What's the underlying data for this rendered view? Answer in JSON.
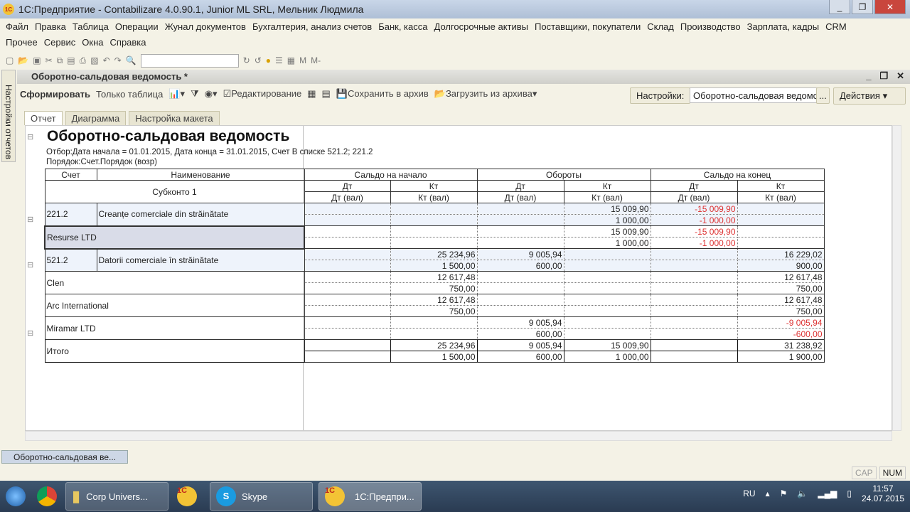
{
  "window": {
    "title": "1С:Предприятие - Contabilizare 4.0.90.1, Junior ML SRL, Мельник Людмила"
  },
  "menu1": [
    "Файл",
    "Правка",
    "Таблица",
    "Операции",
    "Жунал документов",
    "Бухгалтерия, анализ счетов",
    "Банк, касса",
    "Долгосрочные активы",
    "Поставщики, покупатели",
    "Склад",
    "Производство",
    "Зарплата, кадры",
    "CRM"
  ],
  "menu2": [
    "Прочее",
    "Сервис",
    "Окна",
    "Справка"
  ],
  "side_panel": "Настройки отчетов",
  "doc": {
    "title": "Оборотно-сальдовая ведомость *",
    "toolbar": {
      "generate": "Сформировать",
      "table_only": "Только таблица",
      "edit": "Редактирование",
      "save_archive": "Сохранить в архив",
      "load_archive": "Загрузить из архива",
      "settings_label": "Настройки:",
      "settings_value": "Оборотно-сальдовая ведомс",
      "ellipsis": "...",
      "actions": "Действия"
    },
    "tabs": [
      "Отчет",
      "Диаграмма",
      "Настройка макета"
    ]
  },
  "report": {
    "title": "Оборотно-сальдовая ведомость",
    "filter": "Отбор:Дата начала = 01.01.2015, Дата конца = 31.01.2015, Счет В списке 521.2; 221.2",
    "order": "Порядок:Счет.Порядок (возр)",
    "headers": {
      "account": "Счет",
      "name": "Наименование",
      "subconto": "Субконто 1",
      "groups": [
        "Сальдо на начало",
        "Обороты",
        "Сальдо на конец"
      ],
      "dt": "Дт",
      "kt": "Кт",
      "dt_val": "Дт (вал)",
      "kt_val": "Кт (вал)"
    },
    "rows": [
      {
        "type": "group",
        "account": "221.2",
        "name": "Creanțe comerciale din străinătate",
        "l1": [
          "",
          "",
          "",
          "15 009,90",
          "-15 009,90",
          ""
        ],
        "l2": [
          "",
          "",
          "",
          "1 000,00",
          "-1 000,00",
          ""
        ]
      },
      {
        "type": "sub",
        "name": "Resurse LTD",
        "selected": true,
        "l1": [
          "",
          "",
          "",
          "15 009,90",
          "-15 009,90",
          ""
        ],
        "l2": [
          "",
          "",
          "",
          "1 000,00",
          "-1 000,00",
          ""
        ]
      },
      {
        "type": "group",
        "account": "521.2",
        "name": "Datorii comerciale în străinătate",
        "l1": [
          "",
          "25 234,96",
          "9 005,94",
          "",
          "",
          "16 229,02"
        ],
        "l2": [
          "",
          "1 500,00",
          "600,00",
          "",
          "",
          "900,00"
        ]
      },
      {
        "type": "sub",
        "name": "Clen",
        "l1": [
          "",
          "12 617,48",
          "",
          "",
          "",
          "12 617,48"
        ],
        "l2": [
          "",
          "750,00",
          "",
          "",
          "",
          "750,00"
        ]
      },
      {
        "type": "sub",
        "name": "Arc International",
        "l1": [
          "",
          "12 617,48",
          "",
          "",
          "",
          "12 617,48"
        ],
        "l2": [
          "",
          "750,00",
          "",
          "",
          "",
          "750,00"
        ]
      },
      {
        "type": "sub",
        "name": "Miramar LTD",
        "l1": [
          "",
          "",
          "9 005,94",
          "",
          "",
          "-9 005,94"
        ],
        "l2": [
          "",
          "",
          "600,00",
          "",
          "",
          "-600,00"
        ]
      },
      {
        "type": "total",
        "name": "Итого",
        "l1": [
          "",
          "25 234,96",
          "9 005,94",
          "15 009,90",
          "",
          "31 238,92"
        ],
        "l2": [
          "",
          "1 500,00",
          "600,00",
          "1 000,00",
          "",
          "1 900,00"
        ]
      }
    ]
  },
  "window_tab": "Оборотно-сальдовая ве...",
  "status": [
    "CAP",
    "NUM"
  ],
  "taskbar": {
    "items": [
      "Corp Univers...",
      "Skype",
      "1С:Предпри..."
    ],
    "lang": "RU",
    "time": "11:57",
    "date": "24.07.2015"
  },
  "colors": {
    "negative": "#dd3333",
    "group_row": "#eef3fb",
    "selected": "#d9dce8"
  }
}
